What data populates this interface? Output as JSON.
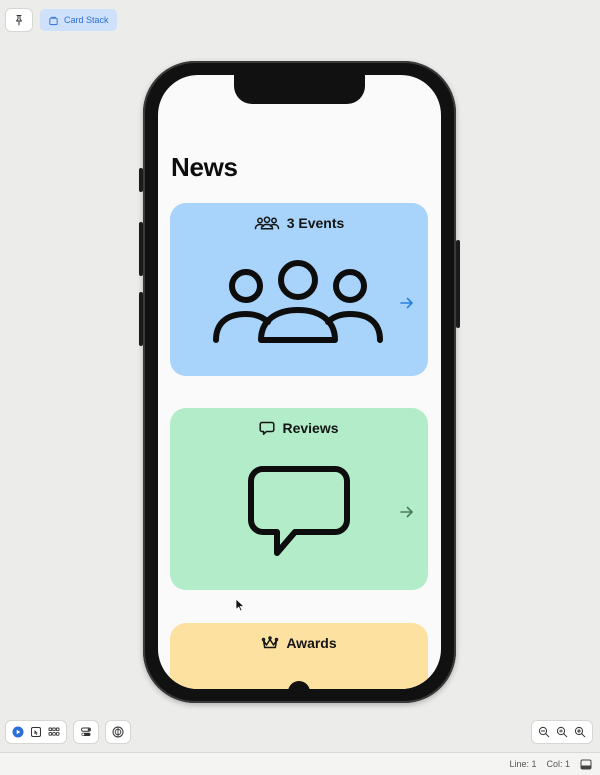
{
  "toolbar": {
    "pin_icon": "pin-icon",
    "preview_label": "Card Stack"
  },
  "screen": {
    "nav_title": "News",
    "cards": [
      {
        "title": "3 Events",
        "icon": "people-icon",
        "color": "#a8d3fa"
      },
      {
        "title": "Reviews",
        "icon": "speech-bubble-icon",
        "color": "#b2ecc8"
      },
      {
        "title": "Awards",
        "icon": "crown-icon",
        "color": "#fde1a1"
      }
    ]
  },
  "bottom_toolbar": {
    "left_icons": [
      "live-preview-icon",
      "selectable-icon",
      "grid-icon",
      "device-settings-icon",
      "color-scheme-icon"
    ],
    "right_icons": [
      "zoom-out-icon",
      "zoom-fit-icon",
      "zoom-in-icon"
    ]
  },
  "status": {
    "line": "Line: 1",
    "col": "Col: 1"
  },
  "colors": {
    "accent": "#2b6fd6",
    "events_arrow": "#2b7fe0",
    "reviews_arrow": "#4a7a5c"
  }
}
